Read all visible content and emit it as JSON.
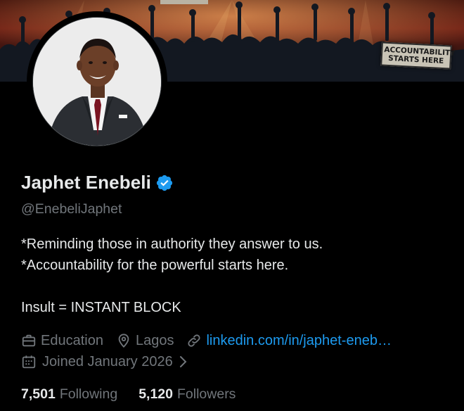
{
  "profile": {
    "display_name": "Japhet Enebeli",
    "handle": "@EnebeliJaphet",
    "bio": "*Reminding those in authority they answer to us.\n*Accountability for the powerful starts here.\n\nInsult = INSTANT BLOCK"
  },
  "banner": {
    "sign_line1": "ACCOUNTABILITY",
    "sign_line2": "STARTS HERE"
  },
  "meta": {
    "category": "Education",
    "location": "Lagos",
    "website": "linkedin.com/in/japhet-eneb…",
    "joined": "Joined January 2026"
  },
  "stats": {
    "following_count": "7,501",
    "following_label": "Following",
    "followers_count": "5,120",
    "followers_label": "Followers"
  },
  "colors": {
    "background": "#000000",
    "primary_text": "#e7e9ea",
    "secondary_text": "#71767b",
    "link": "#1d9bf0",
    "verified_badge": "#1d9bf0"
  },
  "icons": {
    "category": "briefcase-icon",
    "location": "location-pin-icon",
    "website": "link-icon",
    "joined": "calendar-icon",
    "verified": "verified-badge-icon",
    "joined_more": "chevron-right-icon"
  }
}
